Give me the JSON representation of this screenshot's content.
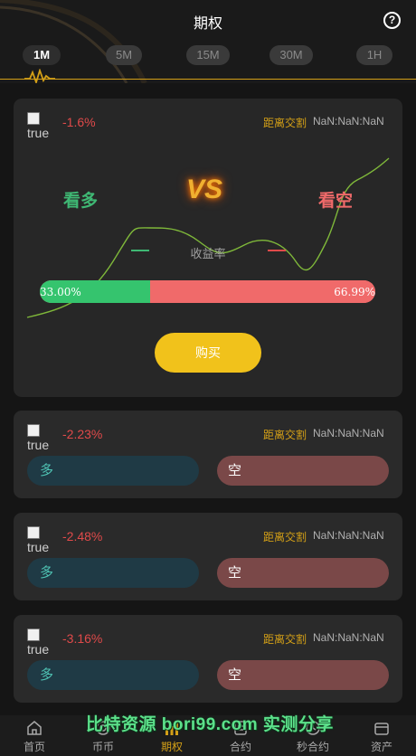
{
  "header": {
    "title": "期权",
    "help_icon": "question-circle-icon"
  },
  "tabs": [
    {
      "label": "1M",
      "active": true
    },
    {
      "label": "5M",
      "active": false
    },
    {
      "label": "15M",
      "active": false
    },
    {
      "label": "30M",
      "active": false
    },
    {
      "label": "1H",
      "active": false
    }
  ],
  "main_card": {
    "coin_image_alt": "true",
    "change": "-1.6%",
    "countdown_label": "距离交割",
    "countdown_value": "NaN:NaN:NaN",
    "long_label": "看多",
    "short_label": "看空",
    "vs_label": "VS",
    "yield_label": "收益率",
    "up_ratio_text": "33.00%",
    "down_ratio_text": "66.99%",
    "up_ratio": 33.0,
    "down_ratio": 66.99,
    "buy_label": "购买"
  },
  "cards": [
    {
      "coin_image_alt": "true",
      "change": "-2.23%",
      "countdown_label": "距离交割",
      "countdown_value": "NaN:NaN:NaN",
      "long_label": "多",
      "short_label": "空"
    },
    {
      "coin_image_alt": "true",
      "change": "-2.48%",
      "countdown_label": "距离交割",
      "countdown_value": "NaN:NaN:NaN",
      "long_label": "多",
      "short_label": "空"
    },
    {
      "coin_image_alt": "true",
      "change": "-3.16%",
      "countdown_label": "距离交割",
      "countdown_value": "NaN:NaN:NaN",
      "long_label": "多",
      "short_label": "空"
    }
  ],
  "nav": [
    {
      "label": "首页",
      "icon": "home-icon",
      "active": false
    },
    {
      "label": "币币",
      "icon": "exchange-icon",
      "active": false
    },
    {
      "label": "期权",
      "icon": "chart-bars-icon",
      "active": true
    },
    {
      "label": "合约",
      "icon": "contract-icon",
      "active": false
    },
    {
      "label": "秒合约",
      "icon": "timer-icon",
      "active": false
    },
    {
      "label": "资产",
      "icon": "wallet-icon",
      "active": false
    }
  ],
  "watermark": "比特资源 bori99.com 实测分享",
  "colors": {
    "accent": "#d4a017",
    "up": "#35c46e",
    "down": "#f06a6a",
    "buy": "#f1c21b",
    "negative": "#e04a4a"
  }
}
